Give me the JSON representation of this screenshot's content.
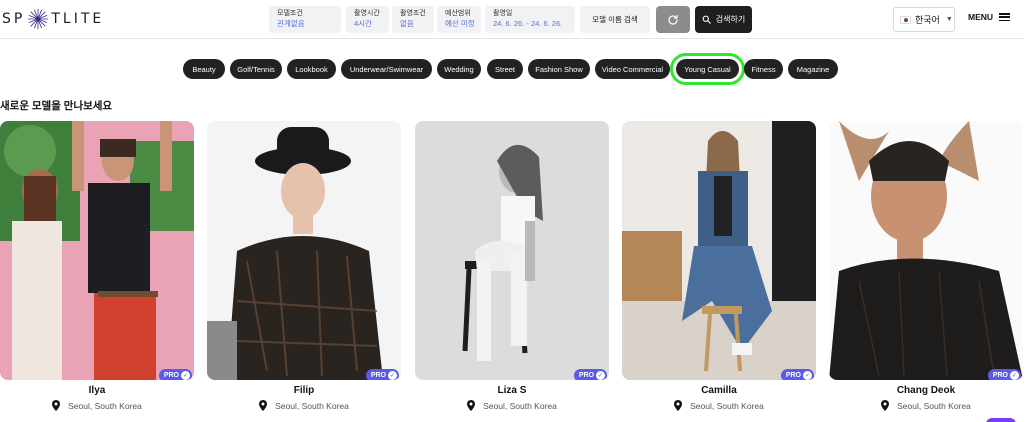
{
  "header": {
    "logo_left": "SP",
    "logo_right": "TLITE",
    "filters": [
      {
        "label": "모델조건",
        "value": "관계없음"
      },
      {
        "label": "촬영시간",
        "value": "4시간"
      },
      {
        "label": "촬영조건",
        "value": "없음"
      },
      {
        "label": "예산범위",
        "value": "예산 미정"
      },
      {
        "label": "촬영일",
        "value": "24. 6. 26. - 24. 6. 26."
      }
    ],
    "name_search_label": "모델 이름 검색",
    "search_button": "검색하기",
    "language": "한국어",
    "menu_label": "MENU"
  },
  "categories": [
    {
      "label": "Beauty",
      "selected": false
    },
    {
      "label": "Golf/Tennis",
      "selected": false
    },
    {
      "label": "Lookbook",
      "selected": false
    },
    {
      "label": "Underwear/Swimwear",
      "selected": false
    },
    {
      "label": "Wedding",
      "selected": false
    },
    {
      "label": "Street",
      "selected": false
    },
    {
      "label": "Fashion Show",
      "selected": false
    },
    {
      "label": "Video Commercial",
      "selected": false
    },
    {
      "label": "Young Casual",
      "selected": true
    },
    {
      "label": "Fitness",
      "selected": false
    },
    {
      "label": "Magazine",
      "selected": false
    }
  ],
  "section_title": "새로운 모델을 만나보세요",
  "models": [
    {
      "name": "Ilya",
      "location": "Seoul, South Korea",
      "badge": "PRO"
    },
    {
      "name": "Filip",
      "location": "Seoul, South Korea",
      "badge": "PRO"
    },
    {
      "name": "Liza S",
      "location": "Seoul, South Korea",
      "badge": "PRO"
    },
    {
      "name": "Camilla",
      "location": "Seoul, South Korea",
      "badge": "PRO"
    },
    {
      "name": "Chang Deok",
      "location": "Seoul, South Korea",
      "badge": "PRO"
    }
  ],
  "colors": {
    "accent": "#5a5ae8",
    "selected_outline": "#2fe62f",
    "chip_bg": "#222222",
    "filter_value": "#5b6fd6"
  }
}
